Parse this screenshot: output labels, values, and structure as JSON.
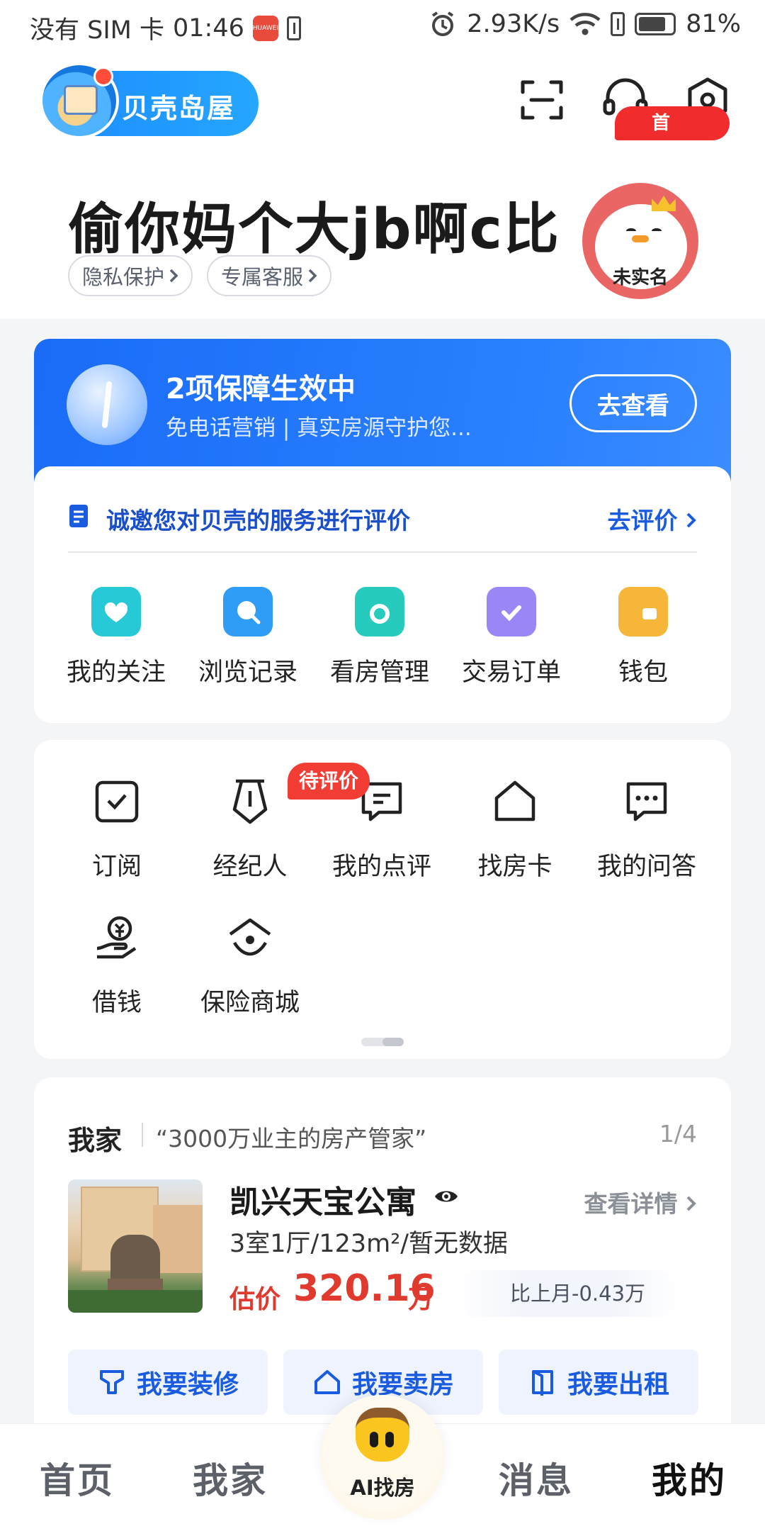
{
  "status_bar": {
    "left_text": "没有 SIM 卡",
    "time": "01:46",
    "huawei_label": "HUAWEI",
    "network_speed": "2.93K/s",
    "battery_percent": "81%",
    "battery_level": 0.81
  },
  "header": {
    "logo_text": "贝壳岛屋",
    "icons": [
      "scan-icon",
      "headset-icon",
      "settings-icon"
    ],
    "username": "偷你妈个大jb啊c比",
    "chips": [
      "隐私保护",
      "专属客服"
    ],
    "avatar_tag": "未实名"
  },
  "protection": {
    "title": "2项保障生效中",
    "subtitle": "免电话营销 | 真实房源守护您...",
    "button": "去查看"
  },
  "evaluation": {
    "text": "诚邀您对贝壳的服务进行评价",
    "link": "去评价"
  },
  "quick_actions": [
    {
      "label": "我的关注",
      "icon": "heart-house-icon",
      "color": "#28c9d6"
    },
    {
      "label": "浏览记录",
      "icon": "search-bubble-icon",
      "color": "#2f9cf5"
    },
    {
      "label": "看房管理",
      "icon": "folder-icon",
      "color": "#26cbbd"
    },
    {
      "label": "交易订单",
      "icon": "clipboard-check-icon",
      "color": "#9b86f5"
    },
    {
      "label": "钱包",
      "icon": "wallet-icon",
      "color": "#f6b63a"
    }
  ],
  "wallet_badge": "首",
  "tools": [
    {
      "label": "订阅"
    },
    {
      "label": "经纪人"
    },
    {
      "label": "我的点评"
    },
    {
      "label": "找房卡"
    },
    {
      "label": "我的问答"
    },
    {
      "label": "借钱"
    },
    {
      "label": "保险商城"
    }
  ],
  "tools_badge": "待评价",
  "home": {
    "title": "我家",
    "slogan": "“3000万业主的房产管家”",
    "page": "1/4",
    "estate_name": "凯兴天宝公寓",
    "detail_link": "查看详情",
    "info": "3室1厅/123m²/暂无数据",
    "price_label": "估价",
    "price_value": "320.16",
    "price_unit": "万",
    "price_change": "比上月-0.43万",
    "actions": [
      "我要装修",
      "我要卖房",
      "我要出租"
    ]
  },
  "bottom_nav": {
    "items": [
      "首页",
      "我家",
      "消息",
      "我的"
    ],
    "ai_label": "AI找房",
    "active": "我的"
  },
  "colors": {
    "brand_blue": "#1a6cf6",
    "price_red": "#e03a2e",
    "badge_red": "#f02c2c"
  }
}
